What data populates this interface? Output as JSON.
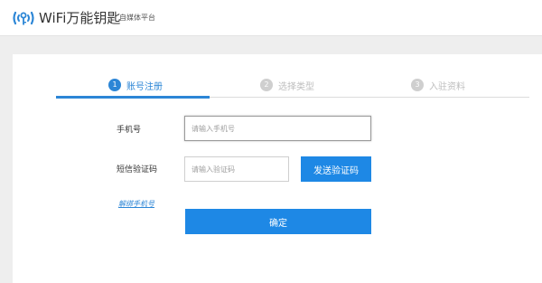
{
  "header": {
    "brand_name": "WiFi万能钥匙",
    "brand_sub": "自媒体平台",
    "logo_icon": "wifi-key-logo-icon",
    "brand_color": "#2c86d6"
  },
  "steps": [
    {
      "num": "1",
      "label": "账号注册",
      "active": true
    },
    {
      "num": "2",
      "label": "选择类型",
      "active": false
    },
    {
      "num": "3",
      "label": "入驻资料",
      "active": false
    }
  ],
  "form": {
    "phone_label": "手机号",
    "phone_placeholder": "请输入手机号",
    "phone_value": "",
    "code_label": "短信验证码",
    "code_placeholder": "请输入验证码",
    "code_value": "",
    "send_code_label": "发送验证码",
    "unbind_link": "解绑手机号",
    "submit_label": "确定"
  },
  "colors": {
    "accent": "#1e88e5",
    "inactive_step": "#cfcfcf",
    "page_background": "#eeeeee"
  }
}
